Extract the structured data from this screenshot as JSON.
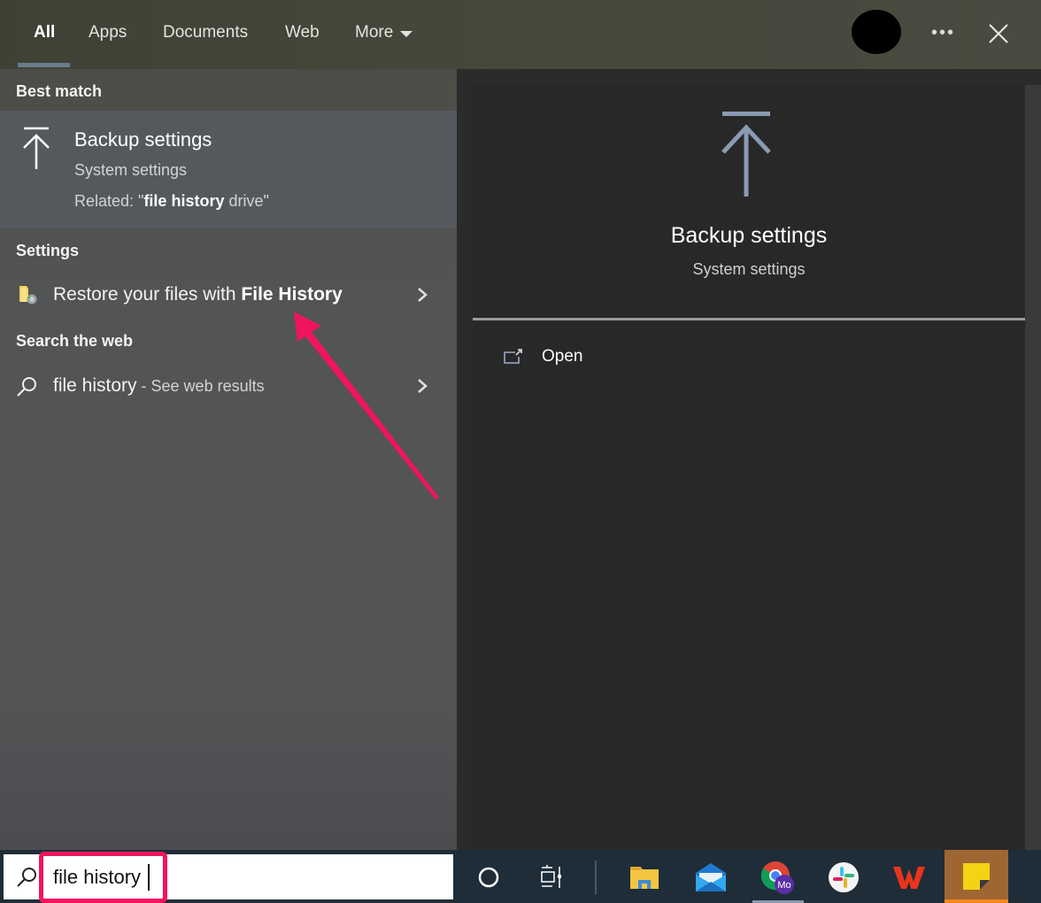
{
  "tabs": [
    {
      "label": "All",
      "active": true
    },
    {
      "label": "Apps"
    },
    {
      "label": "Documents"
    },
    {
      "label": "Web"
    },
    {
      "label": "More"
    }
  ],
  "topbar_icons": {
    "avatar": "user-avatar-redacted",
    "more": "ellipsis-icon",
    "close": "close-icon"
  },
  "left": {
    "best_match_label": "Best match",
    "best_match": {
      "icon": "backup-upload-icon",
      "title": "Backup settings",
      "subtitle": "System settings",
      "related_prefix": "Related: \"",
      "related_bold": "file history",
      "related_suffix": " drive\""
    },
    "settings_label": "Settings",
    "settings_item": {
      "icon": "file-history-folder-icon",
      "text_prefix": "Restore your files with ",
      "text_bold": "File History"
    },
    "web_label": "Search the web",
    "web_item": {
      "icon": "search-icon",
      "query": "file history",
      "suffix": " - See web results"
    }
  },
  "preview": {
    "icon": "backup-upload-icon",
    "title": "Backup settings",
    "subtitle": "System settings",
    "actions": [
      {
        "icon": "open-external-icon",
        "label": "Open"
      }
    ]
  },
  "taskbar": {
    "search_value": "file history",
    "apps": [
      {
        "name": "cortana",
        "icon": "cortana-circle-icon"
      },
      {
        "name": "task-view",
        "icon": "task-view-icon"
      },
      {
        "name": "file-explorer",
        "icon": "folder-icon"
      },
      {
        "name": "mail",
        "icon": "mail-icon"
      },
      {
        "name": "chrome",
        "icon": "chrome-icon",
        "badge": "Mo"
      },
      {
        "name": "slack",
        "icon": "slack-icon"
      },
      {
        "name": "wps-office",
        "icon": "wps-icon"
      },
      {
        "name": "sticky-notes",
        "icon": "sticky-notes-icon",
        "active": true
      }
    ]
  },
  "annotation": {
    "color": "#f0155c"
  },
  "colors": {
    "accent_blue": "#8a9bb2",
    "highlight": "#f0155c",
    "taskbar": "#1f2d38"
  }
}
